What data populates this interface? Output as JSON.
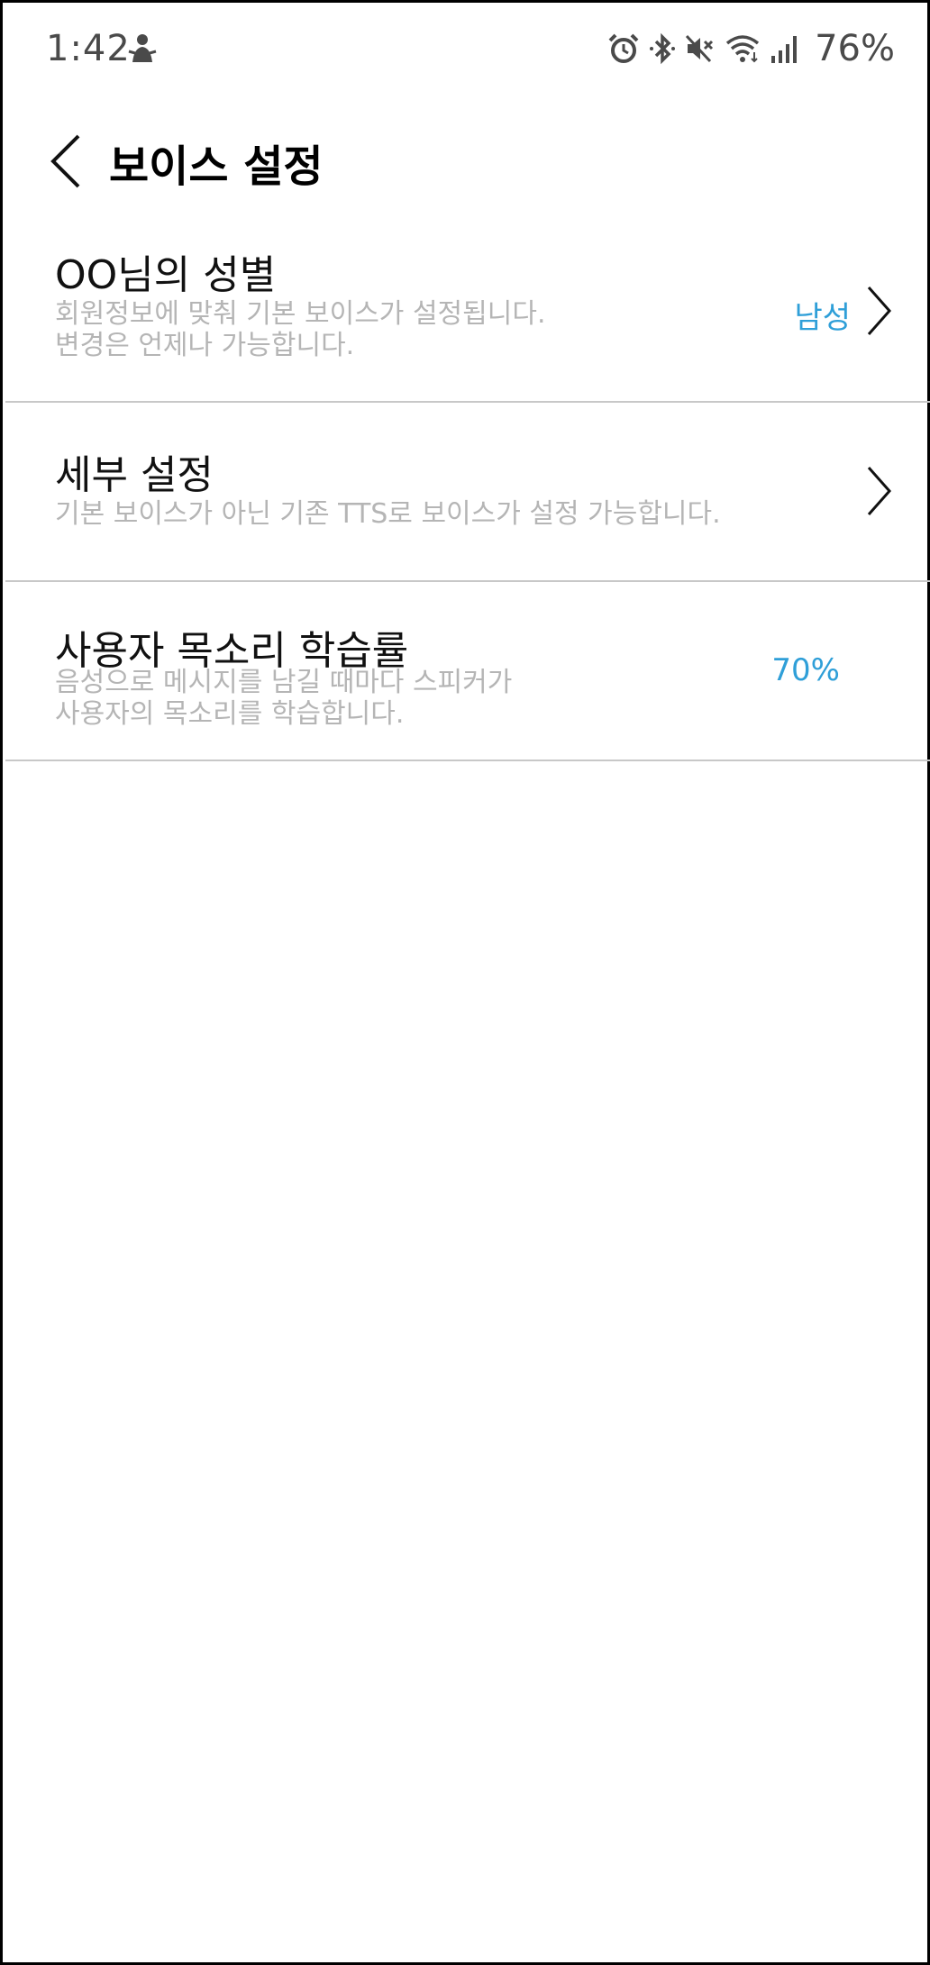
{
  "status_bar": {
    "time": "1:42",
    "battery": "76%",
    "icons": [
      "alarm-icon",
      "bluetooth-icon",
      "mute-icon",
      "wifi-icon",
      "signal-icon"
    ]
  },
  "header": {
    "title": "보이스 설정",
    "back_icon": "chevron-left-icon"
  },
  "settings": [
    {
      "title": "OO님의 성별",
      "description": "회원정보에 맞춰 기본 보이스가 설정됩니다.\n변경은 언제나 가능합니다.",
      "value": "남성",
      "has_chevron": true
    },
    {
      "title": "세부 설정",
      "description": "기본 보이스가 아닌 기존 TTS로 보이스가 설정 가능합니다.",
      "value": "",
      "has_chevron": true
    },
    {
      "title": "사용자 목소리 학습률",
      "description": "음성으로 메시지를 남길 때마다 스피커가\n사용자의 목소리를 학습합니다.",
      "value": "70%",
      "has_chevron": false
    }
  ],
  "colors": {
    "accent": "#2f9fd8",
    "description": "#b5b5b5",
    "divider": "#c8c8c8"
  }
}
